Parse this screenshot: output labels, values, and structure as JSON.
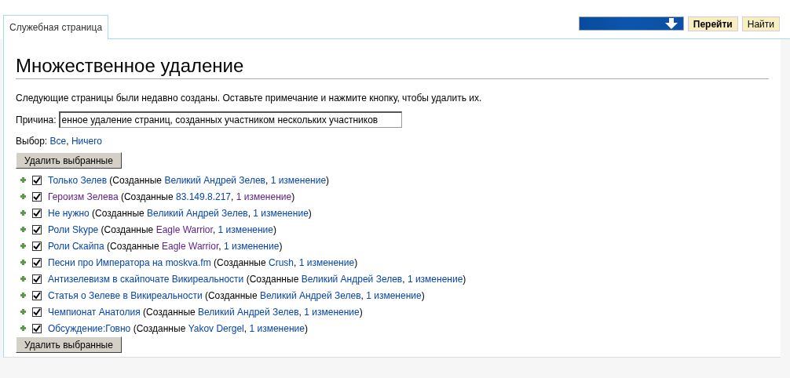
{
  "tab": {
    "label": "Служебная страница",
    "selected": true
  },
  "search": {
    "go_button": "Перейти",
    "find_button": "Найти"
  },
  "title": "Множественное удаление",
  "intro": "Следующие страницы были недавно созданы. Оставьте примечание и нажмите кнопку, чтобы удалить их.",
  "reason": {
    "label": "Причина:",
    "value": "енное удаление страниц, созданных участником нескольких участников"
  },
  "select": {
    "label": "Выбор:",
    "links": [
      {
        "text": "Все",
        "visited": false
      },
      {
        "text": "Ничего",
        "visited": false
      }
    ],
    "sep": ","
  },
  "delete_button_top": "Удалить выбранные",
  "pages": [
    {
      "checked": true,
      "page": {
        "text": "Только Зелев",
        "visited": false
      },
      "open": " (Созданные ",
      "user": {
        "text": "Великий Андрей Зелев",
        "visited": false
      },
      "sep": ", ",
      "edits": {
        "text": "1 изменение",
        "visited": false
      },
      "close": ")"
    },
    {
      "checked": true,
      "page": {
        "text": "Героизм Зелева",
        "visited": true
      },
      "open": " (Созданные ",
      "user": {
        "text": "83.149.8.217",
        "visited": false
      },
      "sep": ", ",
      "edits": {
        "text": "1 изменение",
        "visited": true
      },
      "close": ")"
    },
    {
      "checked": true,
      "page": {
        "text": "Не нужно",
        "visited": false
      },
      "open": " (Созданные ",
      "user": {
        "text": "Великий Андрей Зелев",
        "visited": false
      },
      "sep": ", ",
      "edits": {
        "text": "1 изменение",
        "visited": false
      },
      "close": ")"
    },
    {
      "checked": true,
      "page": {
        "text": "Роли Skype",
        "visited": false
      },
      "open": " (Созданные ",
      "user": {
        "text": "Eagle Warrior",
        "visited": true
      },
      "sep": ", ",
      "edits": {
        "text": "1 изменение",
        "visited": false
      },
      "close": ")"
    },
    {
      "checked": true,
      "page": {
        "text": "Роли Скайпа",
        "visited": false
      },
      "open": " (Созданные ",
      "user": {
        "text": "Eagle Warrior",
        "visited": true
      },
      "sep": ", ",
      "edits": {
        "text": "1 изменение",
        "visited": false
      },
      "close": ")"
    },
    {
      "checked": true,
      "page": {
        "text": "Песни про Императора на moskva.fm",
        "visited": false
      },
      "open": " (Созданные ",
      "user": {
        "text": "Crush",
        "visited": false
      },
      "sep": ", ",
      "edits": {
        "text": "1 изменение",
        "visited": false
      },
      "close": ")"
    },
    {
      "checked": true,
      "page": {
        "text": "Антизелевизм в скайпочате Викиреальности",
        "visited": false
      },
      "open": " (Созданные ",
      "user": {
        "text": "Великий Андрей Зелев",
        "visited": false
      },
      "sep": ", ",
      "edits": {
        "text": "1 изменение",
        "visited": false
      },
      "close": ")"
    },
    {
      "checked": true,
      "page": {
        "text": "Статья о Зелеве в Викиреальности",
        "visited": false
      },
      "open": " (Созданные ",
      "user": {
        "text": "Великий Андрей Зелев",
        "visited": false
      },
      "sep": ", ",
      "edits": {
        "text": "1 изменение",
        "visited": false
      },
      "close": ")"
    },
    {
      "checked": true,
      "page": {
        "text": "Чемпионат Анатолия",
        "visited": false
      },
      "open": " (Созданные ",
      "user": {
        "text": "Великий Андрей Зелев",
        "visited": false
      },
      "sep": ", ",
      "edits": {
        "text": "1 изменение",
        "visited": false
      },
      "close": ")"
    },
    {
      "checked": true,
      "page": {
        "text": "Обсуждение:Говно",
        "visited": false
      },
      "open": " (Созданные ",
      "user": {
        "text": "Yakov Dergel",
        "visited": false
      },
      "sep": ", ",
      "edits": {
        "text": "1 изменение",
        "visited": false
      },
      "close": ")"
    }
  ],
  "delete_button_bottom": "Удалить выбранные"
}
